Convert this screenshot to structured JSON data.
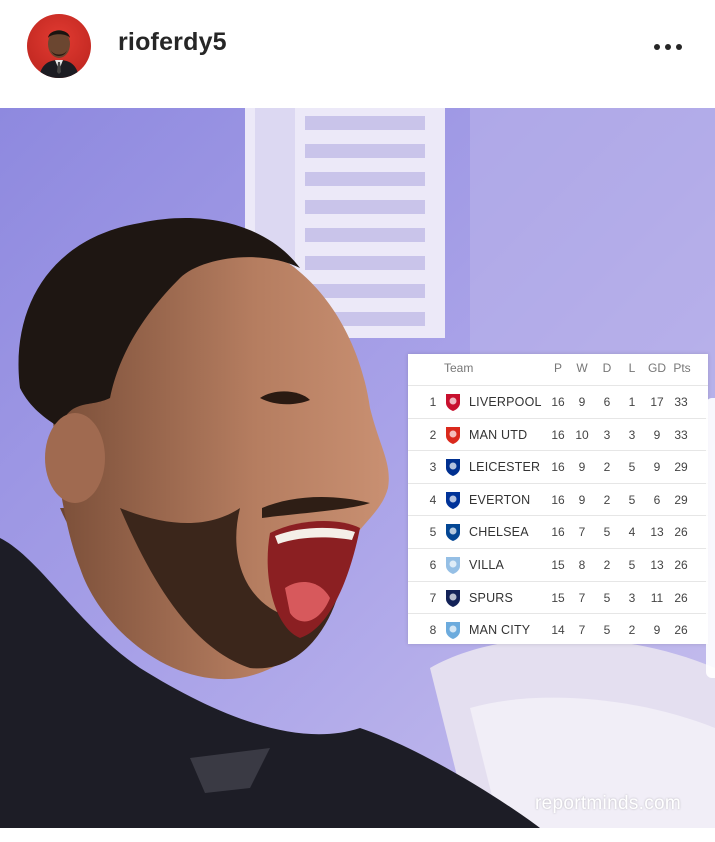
{
  "post": {
    "username": "rioferdy5",
    "watermark": "reportminds.com"
  },
  "icons": {
    "avatar": "profile-avatar",
    "more": "more-options-icon"
  },
  "league_table": {
    "headers": {
      "team": "Team",
      "p": "P",
      "w": "W",
      "d": "D",
      "l": "L",
      "gd": "GD",
      "pts": "Pts"
    },
    "rows": [
      {
        "pos": "1",
        "team": "LIVERPOOL",
        "p": "16",
        "w": "9",
        "d": "6",
        "l": "1",
        "gd": "17",
        "pts": "33",
        "crest_color": "#c8102e"
      },
      {
        "pos": "2",
        "team": "MAN UTD",
        "p": "16",
        "w": "10",
        "d": "3",
        "l": "3",
        "gd": "9",
        "pts": "33",
        "crest_color": "#da291c"
      },
      {
        "pos": "3",
        "team": "LEICESTER",
        "p": "16",
        "w": "9",
        "d": "2",
        "l": "5",
        "gd": "9",
        "pts": "29",
        "crest_color": "#003090"
      },
      {
        "pos": "4",
        "team": "EVERTON",
        "p": "16",
        "w": "9",
        "d": "2",
        "l": "5",
        "gd": "6",
        "pts": "29",
        "crest_color": "#003399"
      },
      {
        "pos": "5",
        "team": "CHELSEA",
        "p": "16",
        "w": "7",
        "d": "5",
        "l": "4",
        "gd": "13",
        "pts": "26",
        "crest_color": "#034694"
      },
      {
        "pos": "6",
        "team": "VILLA",
        "p": "15",
        "w": "8",
        "d": "2",
        "l": "5",
        "gd": "13",
        "pts": "26",
        "crest_color": "#95bfe5"
      },
      {
        "pos": "7",
        "team": "SPURS",
        "p": "15",
        "w": "7",
        "d": "5",
        "l": "3",
        "gd": "11",
        "pts": "26",
        "crest_color": "#132257"
      },
      {
        "pos": "8",
        "team": "MAN CITY",
        "p": "14",
        "w": "7",
        "d": "5",
        "l": "2",
        "gd": "9",
        "pts": "26",
        "crest_color": "#6cabdd"
      }
    ]
  }
}
